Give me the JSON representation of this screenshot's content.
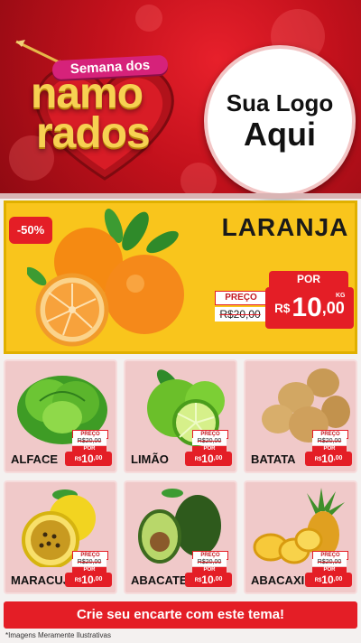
{
  "header": {
    "brand_top": "Semana dos",
    "brand_line1": "namo",
    "brand_line2": "rados",
    "logo_line1": "Sua Logo",
    "logo_line2": "Aqui"
  },
  "feature": {
    "name": "LARANJA",
    "discount": "-50%",
    "label_por": "POR",
    "label_preco": "PREÇO",
    "old_price": "R$20,00",
    "currency": "R$",
    "new_price_int": "10",
    "new_price_dec": ",00",
    "unit": "KG"
  },
  "products": [
    {
      "name": "ALFACE",
      "preco": "PREÇO",
      "old": "R$20,00",
      "por": "POR",
      "cur": "R$",
      "int": "10",
      "dec": ",00"
    },
    {
      "name": "LIMÃO",
      "preco": "PREÇO",
      "old": "R$20,00",
      "por": "POR",
      "cur": "R$",
      "int": "10",
      "dec": ",00"
    },
    {
      "name": "BATATA",
      "preco": "PREÇO",
      "old": "R$20,00",
      "por": "POR",
      "cur": "R$",
      "int": "10",
      "dec": ",00"
    },
    {
      "name": "MARACUJÁ",
      "preco": "PREÇO",
      "old": "R$20,00",
      "por": "POR",
      "cur": "R$",
      "int": "10",
      "dec": ",00"
    },
    {
      "name": "ABACATE",
      "preco": "PREÇO",
      "old": "R$20,00",
      "por": "POR",
      "cur": "R$",
      "int": "10",
      "dec": ",00"
    },
    {
      "name": "ABACAXI",
      "preco": "PREÇO",
      "old": "R$20,00",
      "por": "POR",
      "cur": "R$",
      "int": "10",
      "dec": ",00"
    }
  ],
  "footer": {
    "cta": "Crie seu encarte com este tema!",
    "disclaimer": "*Imagens Meramente Ilustrativas"
  },
  "colors": {
    "brand_red": "#e41e26",
    "feature_yellow": "#f9c51c",
    "card_pink": "#f0c9c9",
    "gold_text": "#f7d152"
  }
}
